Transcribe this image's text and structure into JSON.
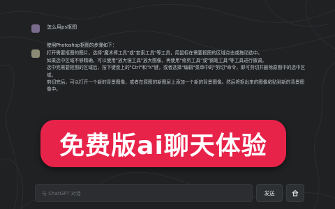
{
  "colors": {
    "background": "#1f2123",
    "promo_banner": "#e8234a",
    "promo_shadow": "#2e7a4a",
    "user_avatar": "#7a6b8c",
    "bot_avatar": "#8c8b76"
  },
  "chat": {
    "user_message": "怎么用ps抠图",
    "bot_intro": "使用Photoshop抠图的步骤如下：",
    "bot_lines": [
      "打开需要抠图的图片，选择\"魔术棒工具\"或\"套索工具\"等工具，用鼠标在需要抠图的区域点击或拖动选中。",
      "如果选中区域不够精确，可以使用\"放大镜工具\"放大图像，再使用\"修剪工具\"或\"钢笔工具\"等工具进行微调。",
      "选中完需要抠图的区域后，按下键盘上的\"Ctrl\"和\"X\"键，或者选择\"编辑\"菜单中的\"剪切\"命令，即可剪切并删除原图中的选中区域。",
      "剪切完后，可以打开一个新的背景图像，或者在原图的新图层上添加一个新的背景图像。然后将抠出来的图像粘贴到新的背景图像中。"
    ]
  },
  "promo": {
    "text": "免费版ai聊天体验"
  },
  "input": {
    "placeholder": "与 ChatGPT 对话",
    "value": ""
  },
  "buttons": {
    "send_label": "发送",
    "home_icon": "home-icon"
  }
}
